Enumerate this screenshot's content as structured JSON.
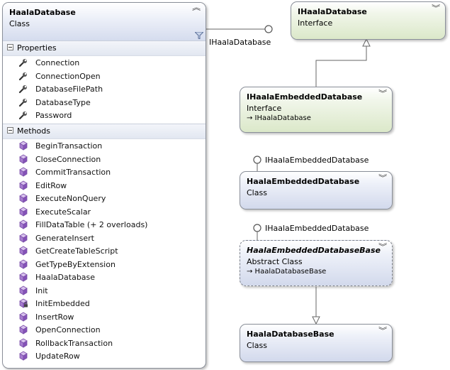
{
  "main_class": {
    "title": "HaalaDatabase",
    "kind": "Class",
    "sections": {
      "properties_label": "Properties",
      "methods_label": "Methods"
    },
    "properties": [
      {
        "label": "Connection",
        "icon": "wrench-icon"
      },
      {
        "label": "ConnectionOpen",
        "icon": "wrench-icon"
      },
      {
        "label": "DatabaseFilePath",
        "icon": "wrench-icon"
      },
      {
        "label": "DatabaseType",
        "icon": "wrench-icon"
      },
      {
        "label": "Password",
        "icon": "wrench-icon"
      }
    ],
    "methods": [
      {
        "label": "BeginTransaction",
        "icon": "method-cube-icon"
      },
      {
        "label": "CloseConnection",
        "icon": "method-cube-icon"
      },
      {
        "label": "CommitTransaction",
        "icon": "method-cube-icon"
      },
      {
        "label": "EditRow",
        "icon": "method-cube-icon"
      },
      {
        "label": "ExecuteNonQuery",
        "icon": "method-cube-icon"
      },
      {
        "label": "ExecuteScalar",
        "icon": "method-cube-icon"
      },
      {
        "label": "FillDataTable (+ 2 overloads)",
        "icon": "method-cube-icon"
      },
      {
        "label": "GenerateInsert",
        "icon": "method-cube-icon"
      },
      {
        "label": "GetCreateTableScript",
        "icon": "method-cube-icon"
      },
      {
        "label": "GetTypeByExtension",
        "icon": "method-cube-icon"
      },
      {
        "label": "HaalaDatabase",
        "icon": "method-cube-icon"
      },
      {
        "label": "Init",
        "icon": "method-cube-icon"
      },
      {
        "label": "InitEmbedded",
        "icon": "private-method-cube-icon"
      },
      {
        "label": "InsertRow",
        "icon": "method-cube-icon"
      },
      {
        "label": "OpenConnection",
        "icon": "method-cube-icon"
      },
      {
        "label": "RollbackTransaction",
        "icon": "method-cube-icon"
      },
      {
        "label": "UpdateRow",
        "icon": "method-cube-icon"
      }
    ]
  },
  "lollipops": {
    "main": "IHaalaDatabase",
    "embedded_class": "IHaalaEmbeddedDatabase",
    "embedded_base": "IHaalaEmbeddedDatabase"
  },
  "shapes": {
    "ihaala_database": {
      "title": "IHaalaDatabase",
      "kind": "Interface"
    },
    "ihaala_embedded_database": {
      "title": "IHaalaEmbeddedDatabase",
      "kind": "Interface",
      "inherits": "→ IHaalaDatabase"
    },
    "haala_embedded_database": {
      "title": "HaalaEmbeddedDatabase",
      "kind": "Class"
    },
    "haala_embedded_database_base": {
      "title": "HaalaEmbeddedDatabaseBase",
      "kind": "Abstract Class",
      "inherits": "→ HaalaDatabaseBase"
    },
    "haala_database_base": {
      "title": "HaalaDatabaseBase",
      "kind": "Class"
    }
  },
  "colors": {
    "class_fill": "#d2d9ec",
    "interface_fill": "#dbe8c9",
    "border": "#8a8f99"
  }
}
